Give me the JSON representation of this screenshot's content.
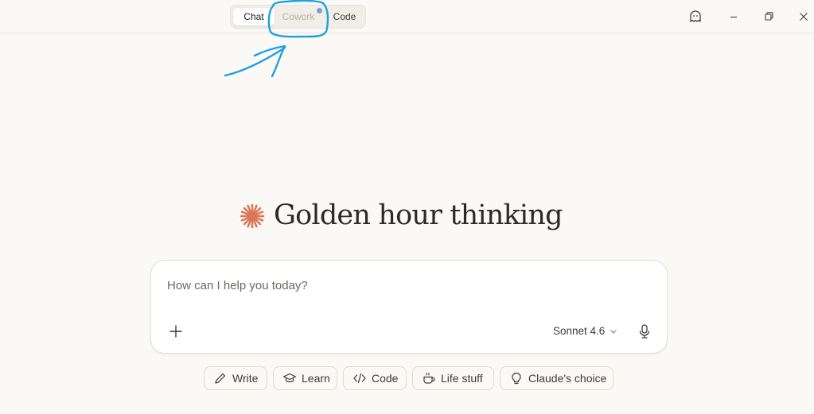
{
  "topbar": {
    "tabs": [
      {
        "label": "Chat",
        "state": "selected"
      },
      {
        "label": "Cowork",
        "state": "disabled"
      },
      {
        "label": "Code",
        "state": "normal"
      }
    ],
    "icons": [
      "ghost-icon",
      "minimize-icon",
      "restore-icon",
      "close-icon"
    ]
  },
  "annotation": {
    "color": "#1fa0e0"
  },
  "hero": {
    "headline": "Golden hour thinking",
    "spark_color": "#d97757"
  },
  "composer": {
    "placeholder": "How can I help you today?",
    "value": "",
    "model": "Sonnet 4.6"
  },
  "chips": [
    {
      "label": "Write",
      "icon": "pencil-icon"
    },
    {
      "label": "Learn",
      "icon": "graduation-cap-icon"
    },
    {
      "label": "Code",
      "icon": "code-icon"
    },
    {
      "label": "Life stuff",
      "icon": "coffee-cup-icon"
    },
    {
      "label": "Claude's choice",
      "icon": "lightbulb-icon"
    }
  ]
}
